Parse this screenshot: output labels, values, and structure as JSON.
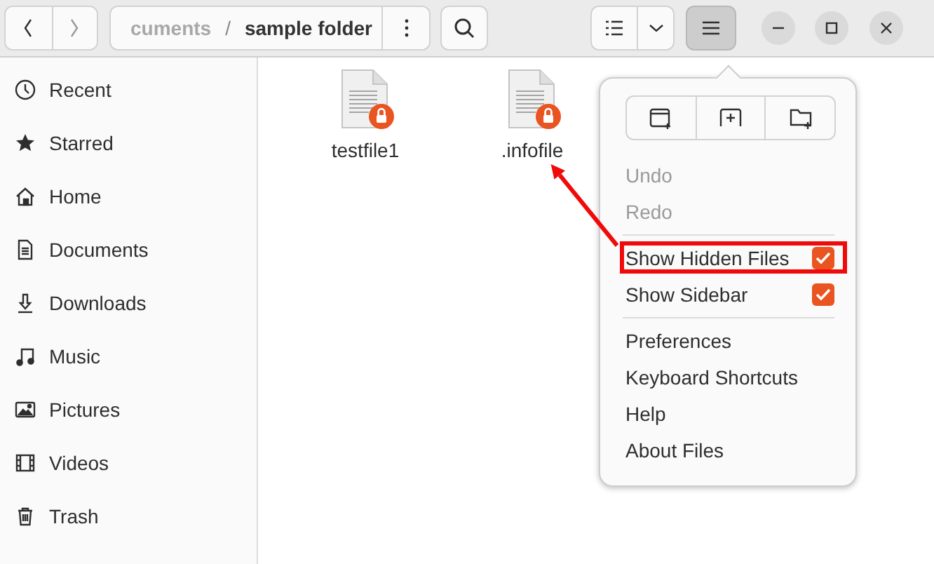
{
  "header": {
    "path": [
      {
        "label": "cuments",
        "current": false
      },
      {
        "label": "sample folder",
        "current": true
      }
    ],
    "path_separator": "/",
    "menu_open": true
  },
  "sidebar": {
    "items": [
      {
        "label": "Recent"
      },
      {
        "label": "Starred"
      },
      {
        "label": "Home"
      },
      {
        "label": "Documents"
      },
      {
        "label": "Downloads"
      },
      {
        "label": "Music"
      },
      {
        "label": "Pictures"
      },
      {
        "label": "Videos"
      },
      {
        "label": "Trash"
      }
    ]
  },
  "files": [
    {
      "name": "testfile1",
      "locked": true,
      "annotated": false
    },
    {
      "name": ".infofile",
      "locked": true,
      "annotated": true
    }
  ],
  "menu": {
    "items": [
      {
        "kind": "action",
        "label": "Undo",
        "disabled": true
      },
      {
        "kind": "action",
        "label": "Redo",
        "disabled": true
      },
      {
        "kind": "separator"
      },
      {
        "kind": "check",
        "label": "Show Hidden Files",
        "checked": true,
        "annotated": true
      },
      {
        "kind": "check",
        "label": "Show Sidebar",
        "checked": true,
        "annotated": false
      },
      {
        "kind": "separator"
      },
      {
        "kind": "action",
        "label": "Preferences",
        "disabled": false
      },
      {
        "kind": "action",
        "label": "Keyboard Shortcuts",
        "disabled": false
      },
      {
        "kind": "action",
        "label": "Help",
        "disabled": false
      },
      {
        "kind": "action",
        "label": "About Files",
        "disabled": false
      }
    ]
  }
}
